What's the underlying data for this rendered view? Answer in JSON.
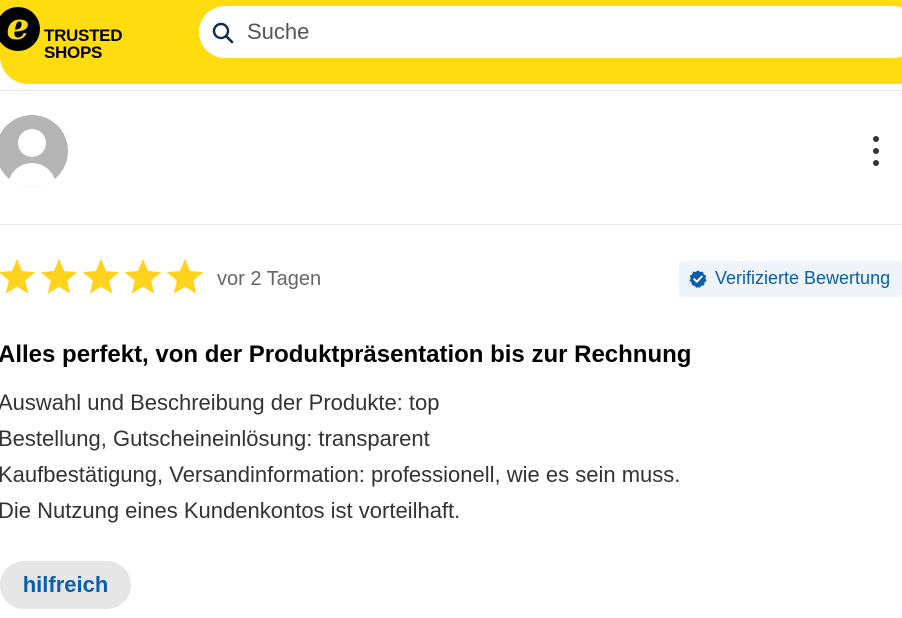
{
  "header": {
    "logo_line1": "TRUSTED",
    "logo_line2": "SHOPS",
    "logo_mark": "e",
    "search_placeholder": "Suche",
    "search_icon": "search-icon"
  },
  "reviewer": {
    "avatar_icon": "user-avatar-icon",
    "menu_icon": "more-vertical-icon"
  },
  "review": {
    "rating": 5,
    "rating_max": 5,
    "date": "vor 2 Tagen",
    "verified_label": "Verifizierte Bewertung",
    "verified_icon": "verified-badge-icon",
    "title": "Alles perfekt, von der Produktpräsentation bis zur Rechnung",
    "lines": [
      "Auswahl und Beschreibung der Produkte: top",
      "Bestellung, Gutscheineinlösung: transparent",
      "Kaufbestätigung, Versandinformation: professionell, wie es sein muss.",
      "Die Nutzung eines Kundenkontos ist vorteilhaft."
    ],
    "helpful_label": "hilfreich"
  },
  "colors": {
    "brand_yellow": "#ffdc0f",
    "star": "#ffd21e",
    "link_blue": "#0b5ea8",
    "verified_bg": "#eef4fa"
  }
}
